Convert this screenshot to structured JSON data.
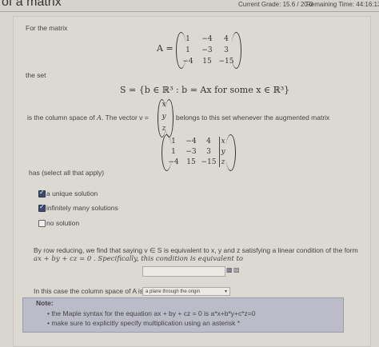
{
  "header": {
    "title": "of a matrix",
    "grade": "Current Grade: 15.6 / 20.0",
    "remaining": "Remaining Time:  44:16:13"
  },
  "problem": {
    "intro": "For the matrix",
    "matrix_label": "A =",
    "matrix": [
      [
        "1",
        "−4",
        "4"
      ],
      [
        "1",
        "−3",
        "3"
      ],
      [
        "−4",
        "15",
        "−15"
      ]
    ],
    "set_label": "the set",
    "set_def": "S = {b ∈ ℝ³ : b = Ax   for some   x ∈ ℝ³}",
    "column_space_text_a": "is the column space of ",
    "column_space_text_b": "A",
    "column_space_text_c": ". The vector  v =",
    "vector": [
      "x",
      "y",
      "z"
    ],
    "belongs_text": "belongs to this set whenever the augmented matrix",
    "aug_matrix": [
      [
        "1",
        "−4",
        "4",
        "x"
      ],
      [
        "1",
        "−3",
        "3",
        "y"
      ],
      [
        "−4",
        "15",
        "−15",
        "z"
      ]
    ],
    "has_text": "has (select all that apply)"
  },
  "options": [
    {
      "label": "a unique solution",
      "checked": true
    },
    {
      "label": "infinitely many solutions",
      "checked": true
    },
    {
      "label": "no solution",
      "checked": false
    }
  ],
  "row_reduce": {
    "line1": "By row reducing, we find that saying v ∈ S is equivalent to x, y  and z satisfying a linear condition of the form",
    "line2": "ax + by + cz = 0 .  Specifically, this condition is equivalent to"
  },
  "column_space": {
    "prefix": "In this case the column space of A is",
    "selected": "a plane through the origin",
    "chevron": "▾"
  },
  "note": {
    "title": "Note:",
    "items": [
      "the Maple syntax for the equation ax + by + cz = 0 is a*x+b*y+c*z=0",
      "make sure to explicitly specify multiplication using an asterisk *"
    ]
  }
}
